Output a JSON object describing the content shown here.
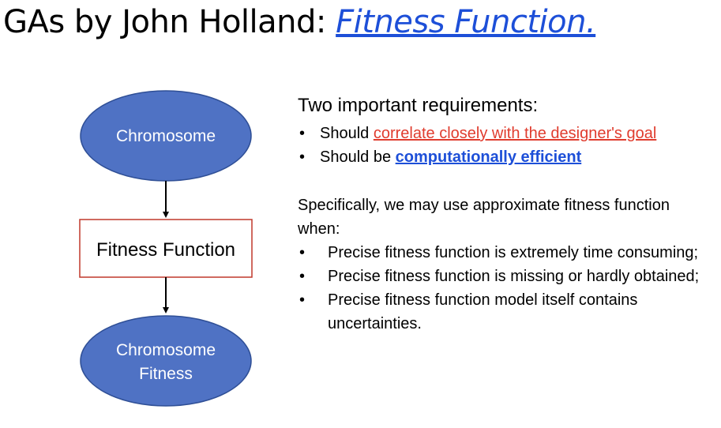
{
  "title": {
    "prefix": "GAs by John Holland: ",
    "link_text": "Fitness Function."
  },
  "diagram": {
    "top_node": "Chromosome",
    "middle_node": "Fitness Function",
    "bottom_node_line1": "Chromosome",
    "bottom_node_line2": "Fitness"
  },
  "requirements": {
    "heading": "Two important requirements:",
    "item1_prefix": "Should ",
    "item1_highlight": "correlate closely with the designer's goal",
    "item2_prefix": "Should be ",
    "item2_highlight": "computationally efficient"
  },
  "specifically": {
    "intro": "Specifically, we may use approximate fitness function when:",
    "items": [
      "Precise fitness function is extremely time consuming;",
      "Precise fitness function is missing or hardly obtained;",
      "Precise fitness function model itself contains uncertainties."
    ]
  },
  "colors": {
    "ellipse_fill": "#4f72c4",
    "ellipse_stroke": "#2f4f96",
    "box_stroke": "#c0392b",
    "red_text": "#e03c2e",
    "blue_text": "#1d4fd8"
  }
}
